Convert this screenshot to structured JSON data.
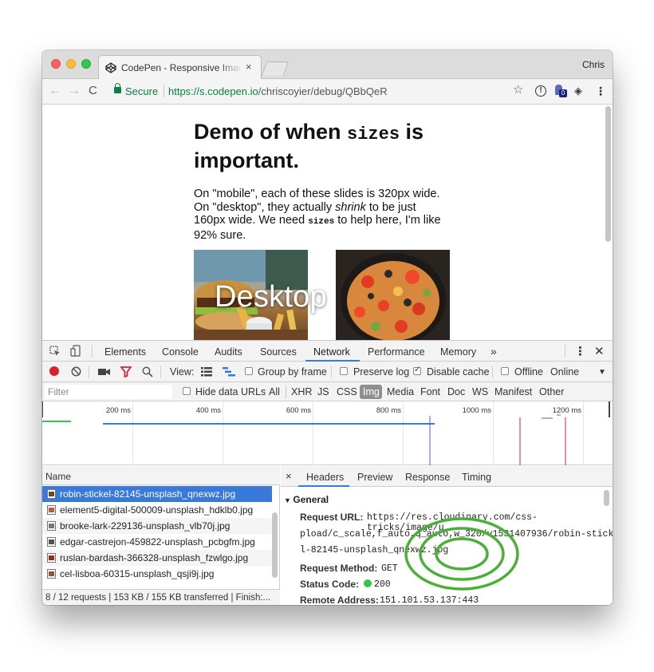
{
  "browser": {
    "tab_title": "CodePen - Responsive Images",
    "tab_close": "×",
    "profile": "Chris",
    "secure_label": "Secure",
    "url_host": "https://s.codepen.io",
    "url_path": "/chriscoyier/debug/QBbQeR",
    "ext_badge": "0"
  },
  "page": {
    "heading_pre": "Demo of when ",
    "heading_code": "sizes",
    "heading_post": " is important.",
    "para_1": "On \"mobile\", each of these slides is 320px wide. On \"desktop\", they actually ",
    "para_em": "shrink",
    "para_2": " to be just 160px wide. We need ",
    "para_code": "sizes",
    "para_3": " to help here, I'm like 92% sure.",
    "overlay_label": "Desktop"
  },
  "devtools": {
    "tabs": [
      "Elements",
      "Console",
      "Audits",
      "Sources",
      "Network",
      "Performance",
      "Memory",
      "»"
    ],
    "active_tab": "Network",
    "toolbar": {
      "view_label": "View:",
      "group_by_frame": "Group by frame",
      "preserve_log": "Preserve log",
      "disable_cache": "Disable cache",
      "offline": "Offline",
      "throttle": "Online"
    },
    "filter": {
      "placeholder": "Filter",
      "hide_data_urls": "Hide data URLs",
      "types": [
        "All",
        "XHR",
        "JS",
        "CSS",
        "Img",
        "Media",
        "Font",
        "Doc",
        "WS",
        "Manifest",
        "Other"
      ],
      "active_type": "Img"
    },
    "timeline_ticks": [
      "200 ms",
      "400 ms",
      "600 ms",
      "800 ms",
      "1000 ms",
      "1200 ms"
    ],
    "name_header": "Name",
    "requests": [
      "robin-stickel-82145-unsplash_qnexwz.jpg",
      "element5-digital-500009-unsplash_hdklb0.jpg",
      "brooke-lark-229136-unsplash_vlb70j.jpg",
      "edgar-castrejon-459822-unsplash_pcbgfm.jpg",
      "ruslan-bardash-366328-unsplash_fzwlgo.jpg",
      "cel-lisboa-60315-unsplash_qsji9j.jpg"
    ],
    "status_bar": "8 / 12 requests | 153 KB / 155 KB transferred | Finish:...",
    "detail_tabs": [
      "Headers",
      "Preview",
      "Response",
      "Timing"
    ],
    "detail_close": "×",
    "general": {
      "title": "General",
      "request_url_key": "Request URL:",
      "request_url_line1": "https://res.cloudinary.com/css-tricks/image/u",
      "request_url_line2": "pload/c_scale,f_auto,q_auto,w_320/v1531407936/robin-sticke",
      "request_url_line3": "l-82145-unsplash_qnexwz.jpg",
      "method_key": "Request Method:",
      "method_val": "GET",
      "status_key": "Status Code:",
      "status_val": "200",
      "remote_key": "Remote Address:",
      "remote_val": "151.101.53.137:443"
    }
  },
  "colors": {
    "accent": "#3879d9",
    "annotation": "#4caf3a",
    "secure_green": "#0b8043"
  }
}
